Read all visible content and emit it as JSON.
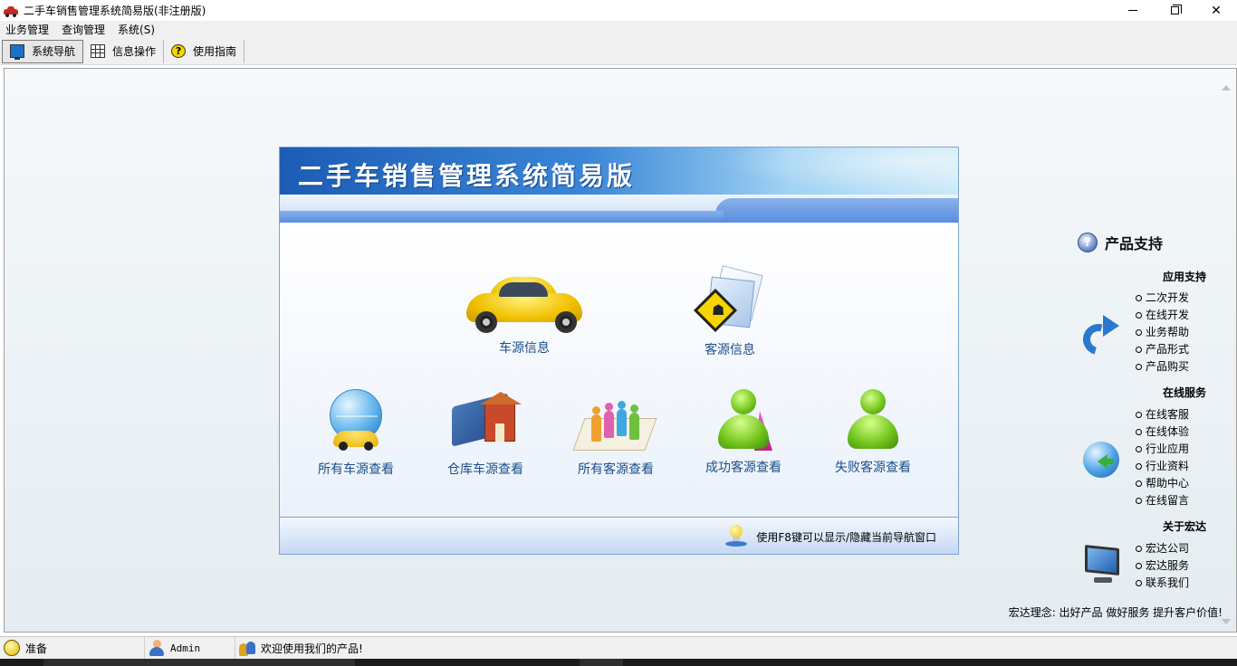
{
  "window": {
    "title": "二手车销售管理系统简易版(非注册版)",
    "controls": {
      "minimize": "minimize",
      "maximize": "restore",
      "close": "✕"
    }
  },
  "menubar": {
    "items": [
      {
        "label": "业务管理"
      },
      {
        "label": "查询管理"
      },
      {
        "label": "系统(S)"
      }
    ]
  },
  "toolbar": {
    "items": [
      {
        "label": "系统导航",
        "icon": "monitor-icon",
        "active": true
      },
      {
        "label": "信息操作",
        "icon": "grid-icon",
        "active": false
      },
      {
        "label": "使用指南",
        "icon": "help-icon",
        "active": false
      }
    ]
  },
  "panel": {
    "title": "二手车销售管理系统简易版",
    "top_items": [
      {
        "label": "车源信息",
        "icon": "yellow-car-icon"
      },
      {
        "label": "客源信息",
        "icon": "pedestrian-sign-folder-icon"
      }
    ],
    "bottom_items": [
      {
        "label": "所有车源查看",
        "icon": "globe-car-icon"
      },
      {
        "label": "仓库车源查看",
        "icon": "book-house-icon"
      },
      {
        "label": "所有客源查看",
        "icon": "people-group-icon"
      },
      {
        "label": "成功客源查看",
        "icon": "green-person-flag-icon"
      },
      {
        "label": "失败客源查看",
        "icon": "green-person-icon"
      }
    ],
    "tip": "使用F8键可以显示/隐藏当前导航窗口"
  },
  "support": {
    "title": "产品支持",
    "sections": [
      {
        "title": "应用支持",
        "links": [
          "二次开发",
          "在线开发",
          "业务帮助",
          "产品形式",
          "产品购买"
        ]
      },
      {
        "title": "在线服务",
        "links": [
          "在线客服",
          "在线体验",
          "行业应用",
          "行业资料",
          "帮助中心",
          "在线留言"
        ]
      },
      {
        "title": "关于宏达",
        "links": [
          "宏达公司",
          "宏达服务",
          "联系我们"
        ]
      }
    ],
    "motto": "宏达理念: 出好产品 做好服务 提升客户价值!"
  },
  "statusbar": {
    "ready": "准备",
    "user": "Admin",
    "welcome": "欢迎使用我们的产品!"
  },
  "colors": {
    "panel_header": "#1c5cb5",
    "nav_label": "#1c4e8a"
  }
}
